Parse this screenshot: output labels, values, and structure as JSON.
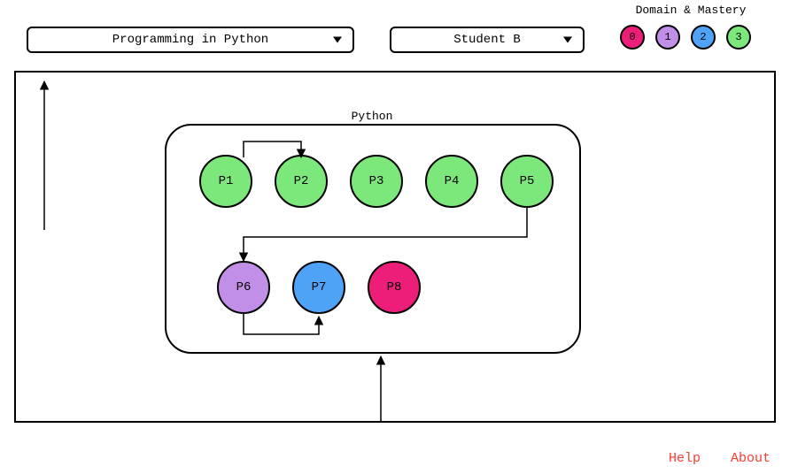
{
  "dropdowns": {
    "course": "Programming in Python",
    "student": "Student B"
  },
  "legend": {
    "title": "Domain & Mastery",
    "levels": [
      {
        "label": "0",
        "class": "c0"
      },
      {
        "label": "1",
        "class": "c1"
      },
      {
        "label": "2",
        "class": "c2"
      },
      {
        "label": "3",
        "class": "c3"
      }
    ]
  },
  "group": {
    "label": "Python"
  },
  "nodes": {
    "p1": "P1",
    "p2": "P2",
    "p3": "P3",
    "p4": "P4",
    "p5": "P5",
    "p6": "P6",
    "p7": "P7",
    "p8": "P8"
  },
  "footer": {
    "help": "Help",
    "about": "About"
  },
  "colors": {
    "0": "#ec1e79",
    "1": "#c18ee8",
    "2": "#4fa3f7",
    "3": "#7ce87c"
  }
}
